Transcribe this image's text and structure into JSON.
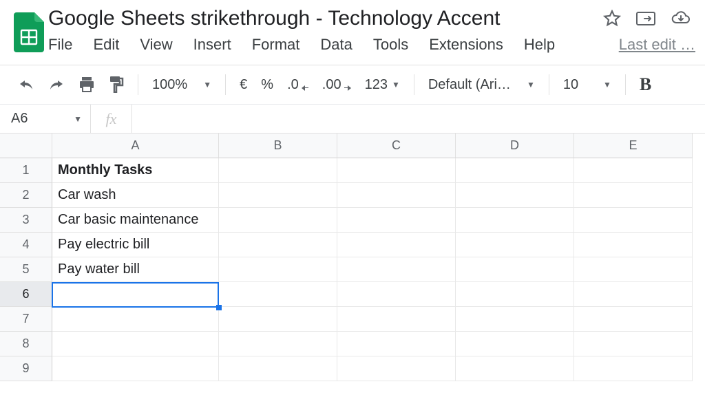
{
  "doc": {
    "title": "Google Sheets strikethrough - Technology Accent"
  },
  "menus": {
    "file": "File",
    "edit": "Edit",
    "view": "View",
    "insert": "Insert",
    "format": "Format",
    "data": "Data",
    "tools": "Tools",
    "extensions": "Extensions",
    "help": "Help",
    "last_edit": "Last edit …"
  },
  "toolbar": {
    "zoom": "100%",
    "currency": "€",
    "percent": "%",
    "dec_less": ".0",
    "dec_more": ".00",
    "num_fmt": "123",
    "font": "Default (Ari…",
    "font_size": "10",
    "bold": "B"
  },
  "fx": {
    "name_box": "A6",
    "label": "fx",
    "value": ""
  },
  "columns": [
    "A",
    "B",
    "C",
    "D",
    "E"
  ],
  "rows": [
    "1",
    "2",
    "3",
    "4",
    "5",
    "6",
    "7",
    "8",
    "9"
  ],
  "cells": {
    "A1": "Monthly Tasks",
    "A2": "Car wash",
    "A3": "Car basic maintenance",
    "A4": "Pay electric bill",
    "A5": "Pay water bill"
  },
  "selection": {
    "cell": "A6"
  }
}
